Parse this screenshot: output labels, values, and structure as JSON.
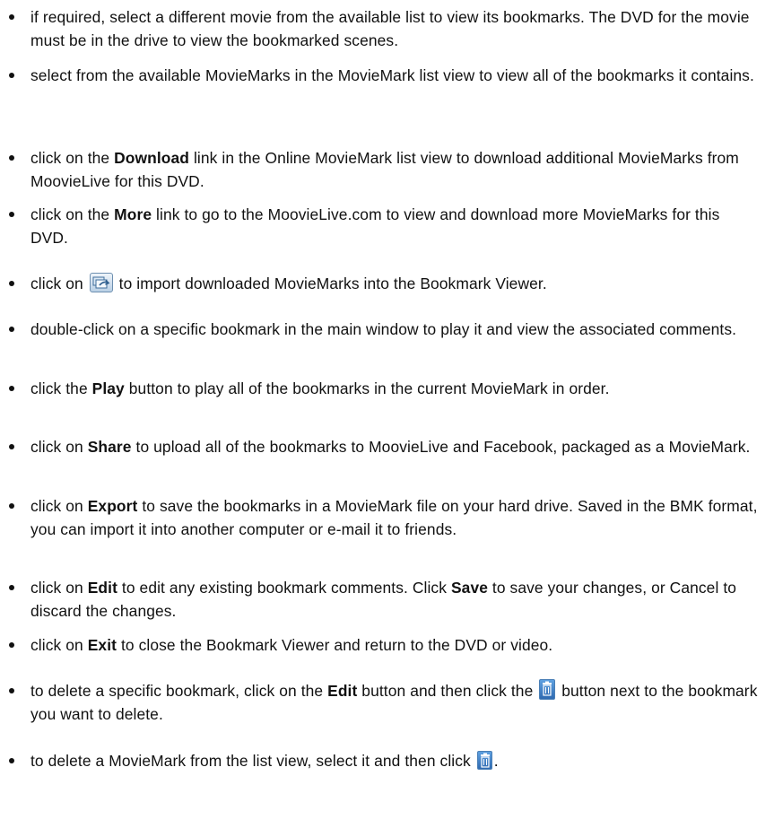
{
  "items": [
    {
      "segments": [
        {
          "t": "if required, select a different movie from the available list to view its bookmarks. The DVD for the movie must be in the drive to view the bookmarked scenes."
        }
      ]
    },
    {
      "segments": [
        {
          "t": "select from the available MovieMarks in the MovieMark list view to view all of the bookmarks it contains."
        }
      ]
    },
    {
      "segments": [
        {
          "t": "click on the "
        },
        {
          "t": "Download",
          "b": true
        },
        {
          "t": " link in the Online MovieMark list view to download additional MovieMarks from MoovieLive for this DVD."
        }
      ]
    },
    {
      "segments": [
        {
          "t": "click on the "
        },
        {
          "t": "More",
          "b": true
        },
        {
          "t": " link to go to the MoovieLive.com to view and download more MovieMarks for this DVD."
        }
      ]
    },
    {
      "segments": [
        {
          "t": "click on "
        },
        {
          "icon": "import-movie-marks-icon"
        },
        {
          "t": " to import downloaded MovieMarks into the Bookmark Viewer."
        }
      ]
    },
    {
      "segments": [
        {
          "t": "double-click on a specific bookmark in the main window to play it and view the associated comments."
        }
      ]
    },
    {
      "segments": [
        {
          "t": "click the "
        },
        {
          "t": "Play",
          "b": true
        },
        {
          "t": " button to play all of the bookmarks in the current MovieMark in order."
        }
      ]
    },
    {
      "segments": [
        {
          "t": "click on "
        },
        {
          "t": "Share",
          "b": true
        },
        {
          "t": " to upload all of the bookmarks to MoovieLive and Facebook, packaged as a MovieMark."
        }
      ]
    },
    {
      "segments": [
        {
          "t": "click on "
        },
        {
          "t": "Export",
          "b": true
        },
        {
          "t": " to save the bookmarks in a MovieMark file on your hard drive. Saved in the BMK format, you can import it into another computer or e-mail it to friends."
        }
      ]
    },
    {
      "segments": [
        {
          "t": "click on "
        },
        {
          "t": "Edit",
          "b": true
        },
        {
          "t": " to edit any existing bookmark comments. Click "
        },
        {
          "t": "Save",
          "b": true
        },
        {
          "t": " to save your changes, or Cancel to discard the changes."
        }
      ]
    },
    {
      "segments": [
        {
          "t": "click on "
        },
        {
          "t": "Exit",
          "b": true
        },
        {
          "t": " to close the Bookmark Viewer and return to the DVD or video."
        }
      ]
    },
    {
      "segments": [
        {
          "t": "to delete a specific bookmark, click on the "
        },
        {
          "t": "Edit",
          "b": true
        },
        {
          "t": " button and then click the "
        },
        {
          "icon": "trash-icon"
        },
        {
          "t": " button next to the bookmark you want to delete."
        }
      ]
    },
    {
      "segments": [
        {
          "t": "to delete a MovieMark from the list view, select it and then click "
        },
        {
          "icon": "trash-icon"
        },
        {
          "t": "."
        }
      ]
    }
  ]
}
